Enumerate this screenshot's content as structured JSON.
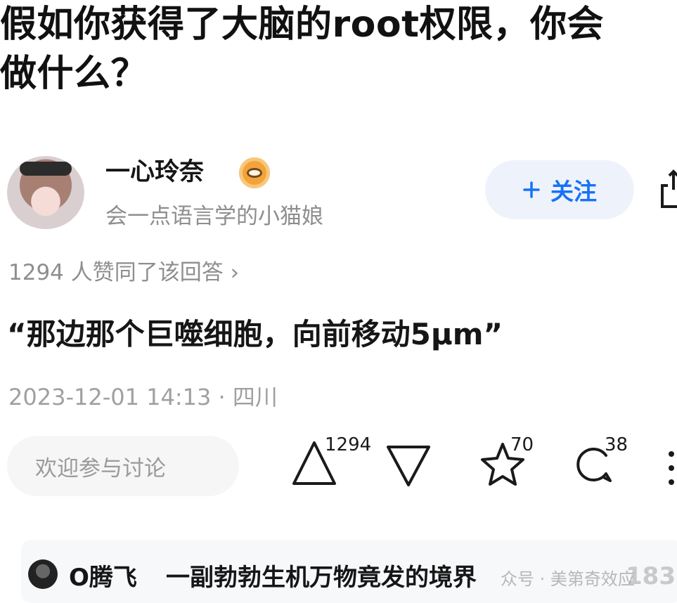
{
  "question": {
    "title_line1": "假如你获得了大脑的root权限，你会",
    "title_line2": "做什么？"
  },
  "author": {
    "name": "一心玲奈",
    "badge_icon": "badge-icon",
    "bio": "会一点语言学的小猫娘",
    "follow_label": "关注",
    "follow_icon": "plus-icon",
    "accent_color": "#1772f6"
  },
  "answer": {
    "vote_summary": "1294 人赞同了该回答 ›",
    "text": "“那边那个巨噬细胞，向前移动5μm”",
    "meta": "2023-12-01 14:13 · 四川"
  },
  "actions": {
    "comment_placeholder": "欢迎参与讨论",
    "upvote_count": "1294",
    "favorite_count": "70",
    "comment_count": "38"
  },
  "comment_preview": {
    "commenter": "O腾飞",
    "text": "一副勃勃生机万物竟发的境界",
    "count_partial": "183"
  },
  "watermark": "众号 · 美第奇效应"
}
